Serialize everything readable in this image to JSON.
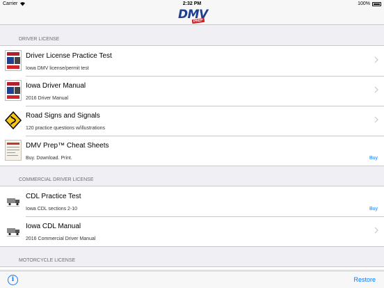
{
  "status_bar": {
    "carrier": "Carrier",
    "time": "2:32 PM",
    "battery": "100%"
  },
  "nav": {
    "logo_text": "DMV",
    "logo_badge": "PREP"
  },
  "sections": [
    {
      "header": "DRIVER LICENSE",
      "rows": [
        {
          "title": "Driver License Practice Test",
          "subtitle": "Iowa DMV license/permit test",
          "accessory": "chevron",
          "icon": "book-cover-icon"
        },
        {
          "title": "Iowa Driver Manual",
          "subtitle": "2016 Driver Manual",
          "accessory": "chevron",
          "icon": "book-cover-icon"
        },
        {
          "title": "Road Signs and Signals",
          "subtitle": "120 practice questions w/illustrations",
          "accessory": "chevron",
          "icon": "winding-road-sign-icon"
        },
        {
          "title": "DMV Prep™ Cheat Sheets",
          "subtitle": "Buy. Download. Print.",
          "accessory": "Buy",
          "icon": "cheat-sheet-icon"
        }
      ]
    },
    {
      "header": "COMMERCIAL DRIVER LICENSE",
      "rows": [
        {
          "title": "CDL Practice Test",
          "subtitle": "Iowa CDL sections 2-10",
          "accessory": "Buy",
          "icon": "truck-icon"
        },
        {
          "title": "Iowa CDL Manual",
          "subtitle": "2016 Commercial Driver Manual",
          "accessory": "chevron",
          "icon": "truck-icon"
        }
      ]
    },
    {
      "header": "MOTORCYCLE LICENSE",
      "rows": []
    }
  ],
  "toolbar": {
    "info_glyph": "i",
    "restore_label": "Restore"
  },
  "colors": {
    "accent": "#0a7aff",
    "sign_yellow": "#f5c518",
    "logo_blue": "#1f3f8f",
    "logo_red": "#d0242b"
  }
}
